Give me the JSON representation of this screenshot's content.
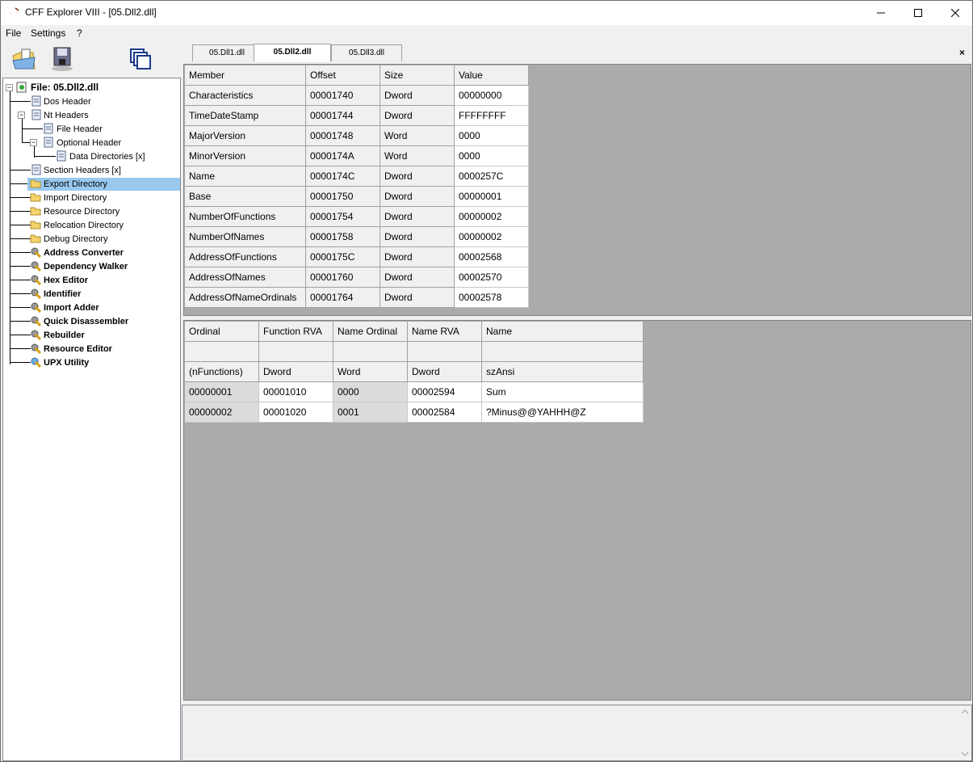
{
  "window": {
    "title": "CFF Explorer VIII - [05.Dll2.dll]"
  },
  "menu": [
    "File",
    "Settings",
    "?"
  ],
  "toolbar": [
    {
      "name": "open-file-icon"
    },
    {
      "name": "save-file-icon"
    },
    {
      "name": "windows-icon"
    }
  ],
  "tree": {
    "root": "File: 05.Dll2.dll",
    "items": [
      {
        "label": "Dos Header",
        "bold": false
      },
      {
        "label": "Nt Headers",
        "bold": false
      },
      {
        "label": "File Header",
        "bold": false
      },
      {
        "label": "Optional Header",
        "bold": false
      },
      {
        "label": "Data Directories [x]",
        "bold": false
      },
      {
        "label": "Section Headers [x]",
        "bold": false
      },
      {
        "label": "Export Directory",
        "bold": false,
        "selected": true
      },
      {
        "label": "Import Directory",
        "bold": false
      },
      {
        "label": "Resource Directory",
        "bold": false
      },
      {
        "label": "Relocation Directory",
        "bold": false
      },
      {
        "label": "Debug Directory",
        "bold": false
      },
      {
        "label": "Address Converter",
        "bold": true
      },
      {
        "label": "Dependency Walker",
        "bold": true
      },
      {
        "label": "Hex Editor",
        "bold": true
      },
      {
        "label": "Identifier",
        "bold": true
      },
      {
        "label": "Import Adder",
        "bold": true
      },
      {
        "label": "Quick Disassembler",
        "bold": true
      },
      {
        "label": "Rebuilder",
        "bold": true
      },
      {
        "label": "Resource Editor",
        "bold": true
      },
      {
        "label": "UPX Utility",
        "bold": true
      }
    ]
  },
  "tabs": [
    {
      "label": "05.Dll1.dll",
      "active": false
    },
    {
      "label": "05.Dll2.dll",
      "active": true
    },
    {
      "label": "05.Dll3.dll",
      "active": false
    }
  ],
  "tab_close": "×",
  "export_table": {
    "headers": [
      "Member",
      "Offset",
      "Size",
      "Value"
    ],
    "rows": [
      [
        "Characteristics",
        "00001740",
        "Dword",
        "00000000"
      ],
      [
        "TimeDateStamp",
        "00001744",
        "Dword",
        "FFFFFFFF"
      ],
      [
        "MajorVersion",
        "00001748",
        "Word",
        "0000"
      ],
      [
        "MinorVersion",
        "0000174A",
        "Word",
        "0000"
      ],
      [
        "Name",
        "0000174C",
        "Dword",
        "0000257C"
      ],
      [
        "Base",
        "00001750",
        "Dword",
        "00000001"
      ],
      [
        "NumberOfFunctions",
        "00001754",
        "Dword",
        "00000002"
      ],
      [
        "NumberOfNames",
        "00001758",
        "Dword",
        "00000002"
      ],
      [
        "AddressOfFunctions",
        "0000175C",
        "Dword",
        "00002568"
      ],
      [
        "AddressOfNames",
        "00001760",
        "Dword",
        "00002570"
      ],
      [
        "AddressOfNameOrdinals",
        "00001764",
        "Dword",
        "00002578"
      ]
    ]
  },
  "functions_table": {
    "headers": [
      "Ordinal",
      "Function RVA",
      "Name Ordinal",
      "Name RVA",
      "Name"
    ],
    "blank_row": [
      "",
      "",
      "",
      "",
      ""
    ],
    "types": [
      "(nFunctions)",
      "Dword",
      "Word",
      "Dword",
      "szAnsi"
    ],
    "rows": [
      [
        "00000001",
        "00001010",
        "0000",
        "00002594",
        "Sum"
      ],
      [
        "00000002",
        "00001020",
        "0001",
        "00002584",
        "?Minus@@YAHHH@Z"
      ]
    ]
  }
}
